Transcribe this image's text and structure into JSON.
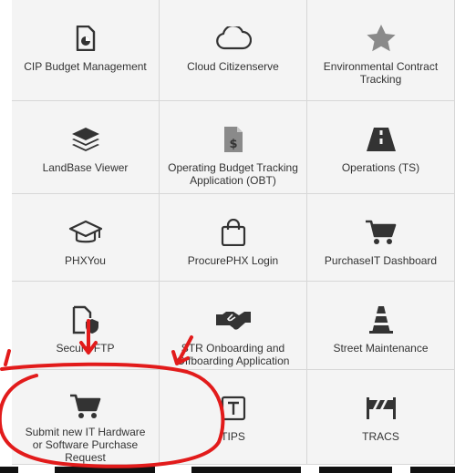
{
  "tiles": [
    {
      "label": "CIP Budget Management",
      "icon": "document-chart-icon"
    },
    {
      "label": "Cloud Citizenserve",
      "icon": "cloud-icon"
    },
    {
      "label": "Environmental Contract Tracking",
      "icon": "star-icon"
    },
    {
      "label": "LandBase Viewer",
      "icon": "layers-icon"
    },
    {
      "label": "Operating Budget Tracking Application (OBT)",
      "icon": "document-dollar-icon"
    },
    {
      "label": "Operations (TS)",
      "icon": "road-icon"
    },
    {
      "label": "PHXYou",
      "icon": "graduation-cap-icon"
    },
    {
      "label": "ProcurePHX Login",
      "icon": "shopping-bag-icon"
    },
    {
      "label": "PurchaseIT Dashboard",
      "icon": "shopping-cart-icon"
    },
    {
      "label": "Secure FTP",
      "icon": "document-shield-icon"
    },
    {
      "label": "STR Onboarding and Offboarding Application",
      "icon": "handshake-icon"
    },
    {
      "label": "Street Maintenance",
      "icon": "traffic-cone-icon"
    },
    {
      "label": "Submit new IT Hardware or Software Purchase Request",
      "icon": "shopping-cart-icon"
    },
    {
      "label": "TIPS",
      "icon": "t-box-icon"
    },
    {
      "label": "TRACS",
      "icon": "barrier-icon"
    }
  ],
  "colors": {
    "tile_bg": "#f4f4f4",
    "border": "#d7d7d7",
    "icon": "#333333",
    "icon_muted": "#8a8a8a",
    "annotation": "#e21b1b"
  }
}
